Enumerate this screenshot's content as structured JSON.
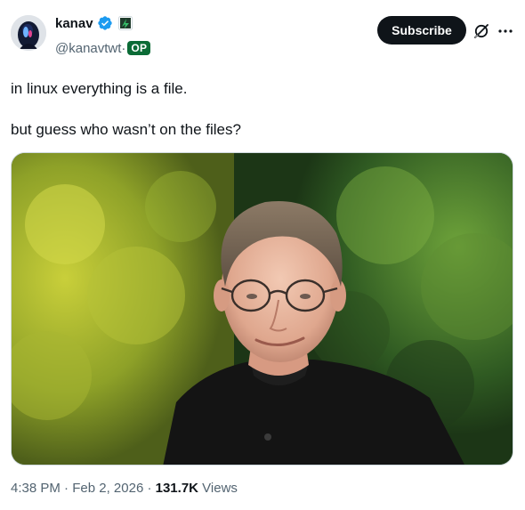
{
  "author": {
    "display_name": "kanav",
    "handle": "@kanavtwt",
    "separator": "·",
    "op_label": "OP",
    "verified_color": "#1d9bf0"
  },
  "actions": {
    "subscribe_label": "Subscribe",
    "grok_icon": "grok-icon",
    "more_icon": "more-icon"
  },
  "tweet": {
    "lines": [
      "in linux everything is a file.",
      "but guess who wasn’t on the files?"
    ]
  },
  "meta": {
    "time": "4:38 PM",
    "dot1": "·",
    "date": "Feb 2, 2026",
    "dot2": "·",
    "views_count": "131.7K",
    "views_label": "Views"
  },
  "colors": {
    "text_primary": "#0f1419",
    "text_secondary": "#536471",
    "op_badge": "#0b6b36",
    "button_bg": "#0f1419"
  }
}
